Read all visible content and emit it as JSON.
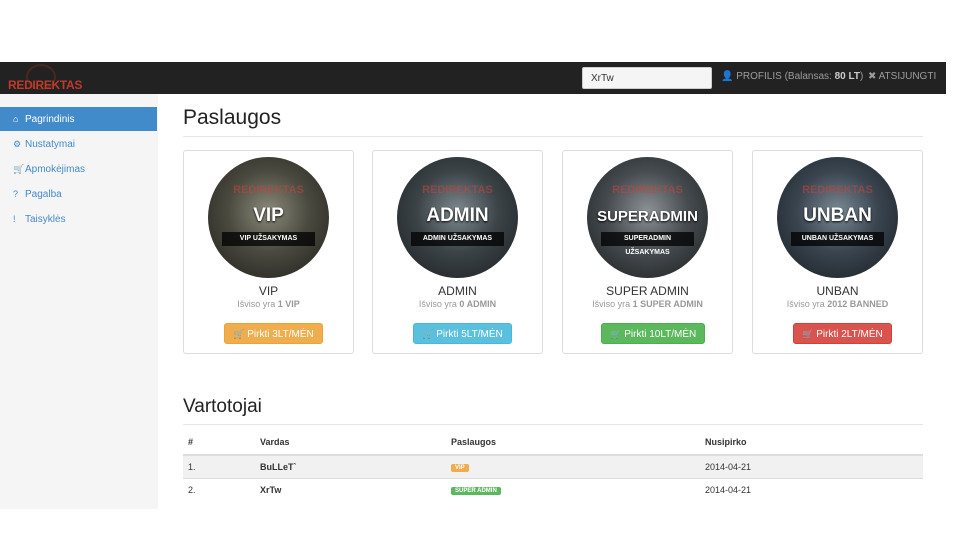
{
  "navbar": {
    "brand": "REDIREKTAS",
    "search_value": "XrTw",
    "profile_prefix": "PROFILIS (Balansas: ",
    "profile_balance": "80 LT",
    "profile_suffix": ")",
    "logout": "ATSIJUNGTI"
  },
  "sidebar": {
    "items": [
      {
        "label": "Pagrindinis",
        "icon": "home-icon",
        "glyph": "⌂"
      },
      {
        "label": "Nustatymai",
        "icon": "gear-icon",
        "glyph": "⚙"
      },
      {
        "label": "Apmokėjimas",
        "icon": "cart-icon",
        "glyph": "🛒"
      },
      {
        "label": "Pagalba",
        "icon": "question-icon",
        "glyph": "?"
      },
      {
        "label": "Taisyklės",
        "icon": "info-icon",
        "glyph": "!"
      }
    ]
  },
  "services": {
    "heading": "Paslaugos",
    "cards": [
      {
        "big": "VIP",
        "band": "VIP UŽSAKYMAS",
        "name": "VIP",
        "count_prefix": "Išviso yra ",
        "count": "1 VIP",
        "button": "Pirkti 3LT/MĖN",
        "color": "#f0ad4e"
      },
      {
        "big": "ADMIN",
        "band": "ADMIN UŽSAKYMAS",
        "name": "ADMIN",
        "count_prefix": "Išviso yra ",
        "count": "0 ADMIN",
        "button": "Pirkti 5LT/MĖN",
        "color": "#5bc0de"
      },
      {
        "big": "SUPERADMIN",
        "band": "SUPERADMIN UŽSAKYMAS",
        "name": "SUPER ADMIN",
        "count_prefix": "Išviso yra ",
        "count": "1 SUPER ADMIN",
        "button": "Pirkti 10LT/MĖN",
        "color": "#5cb85c"
      },
      {
        "big": "UNBAN",
        "band": "UNBAN UŽSAKYMAS",
        "name": "UNBAN",
        "count_prefix": "Išviso yra ",
        "count": "2012 BANNED",
        "button": "Pirkti 2LT/MĖN",
        "color": "#d9534f"
      }
    ],
    "watermark": "REDIREKTAS"
  },
  "users": {
    "heading": "Vartotojai",
    "columns": [
      "#",
      "Vardas",
      "Paslaugos",
      "Nusipirko"
    ],
    "rows": [
      {
        "num": "1.",
        "name": "BuLLeT`",
        "service": "VIP",
        "service_color": "#f0ad4e",
        "date": "2014-04-21"
      },
      {
        "num": "2.",
        "name": "XrTw",
        "service": "SUPER ADMIN",
        "service_color": "#5cb85c",
        "date": "2014-04-21"
      }
    ]
  }
}
